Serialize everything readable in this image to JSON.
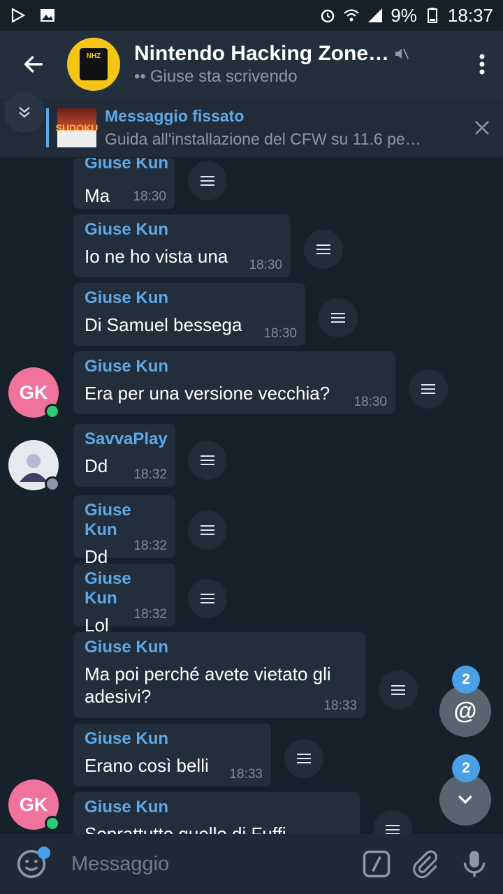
{
  "status_bar": {
    "battery": "9%",
    "time": "18:37"
  },
  "header": {
    "title": "Nintendo Hacking Zone…",
    "subtitle": "Giuse sta scrivendo",
    "avatar_text": "NHZ"
  },
  "pinned": {
    "title": "Messaggio fissato",
    "body": "Guida all'installazione del CFW su 11.6 pe…",
    "thumb_text": "SUDOKU"
  },
  "messages": [
    {
      "sender": "Giuse Kun",
      "text": "Ma",
      "time": "18:30"
    },
    {
      "sender": "Giuse Kun",
      "text": "Io ne ho vista una",
      "time": "18:30"
    },
    {
      "sender": "Giuse Kun",
      "text": "Di Samuel bessega",
      "time": "18:30"
    },
    {
      "sender": "Giuse Kun",
      "text": "Era per una versione vecchia?",
      "time": "18:30"
    },
    {
      "sender": "SavvaPlay",
      "text": "Dd",
      "time": "18:32"
    },
    {
      "sender": "Giuse Kun",
      "text": "Dd",
      "time": "18:32"
    },
    {
      "sender": "Giuse Kun",
      "text": "Lol",
      "time": "18:32"
    },
    {
      "sender": "Giuse Kun",
      "text": "Ma poi perché avete vietato gli adesivi?",
      "time": "18:33"
    },
    {
      "sender": "Giuse Kun",
      "text": "Erano così belli",
      "time": "18:33"
    },
    {
      "sender": "Giuse Kun",
      "text": "Soprattutto quello di Fuffi",
      "time": ""
    }
  ],
  "avatars": {
    "gk_initials": "GK"
  },
  "floating": {
    "mentions_count": "2",
    "scroll_count": "2",
    "mention_symbol": "@"
  },
  "input": {
    "placeholder": "Messaggio"
  },
  "colors": {
    "accent": "#5fa8e6",
    "bubble": "#232e3c",
    "online": "#2ecc71"
  }
}
